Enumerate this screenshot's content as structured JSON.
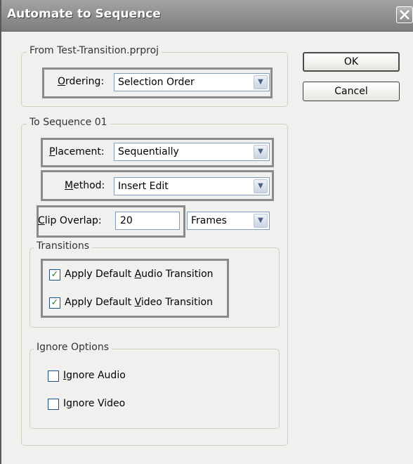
{
  "window": {
    "title": "Automate to Sequence"
  },
  "buttons": {
    "ok": "OK",
    "cancel": "Cancel"
  },
  "from_group": {
    "legend": "From Test-Transition.prproj",
    "ordering": {
      "label_pre": "",
      "label_u": "O",
      "label_post": "rdering:",
      "value": "Selection Order"
    }
  },
  "to_group": {
    "legend": "To Sequence 01",
    "placement": {
      "label_pre": "",
      "label_u": "P",
      "label_post": "lacement:",
      "value": "Sequentially"
    },
    "method": {
      "label_pre": "",
      "label_u": "M",
      "label_post": "ethod:",
      "value": "Insert Edit"
    },
    "clip_overlap": {
      "label_pre": "",
      "label_u": "C",
      "label_post": "lip Overlap:",
      "value": "20",
      "unit": "Frames"
    }
  },
  "transitions": {
    "legend": "Transitions",
    "audio": {
      "label_pre": "Apply Default ",
      "label_u": "A",
      "label_post": "udio Transition",
      "checked": true
    },
    "video": {
      "label_pre": "Apply Default ",
      "label_u": "V",
      "label_post": "ideo Transition",
      "checked": true
    }
  },
  "ignore_options": {
    "legend": "Ignore Options",
    "audio": {
      "label_pre": "",
      "label_u": "I",
      "label_post": "gnore Audio",
      "checked": false
    },
    "video": {
      "label_pre": "I",
      "label_u": "g",
      "label_post": "nore Video",
      "checked": false
    }
  },
  "icons": {
    "close": "close-icon",
    "dropdown": "chevron-down-icon",
    "check": "checkmark-icon"
  }
}
